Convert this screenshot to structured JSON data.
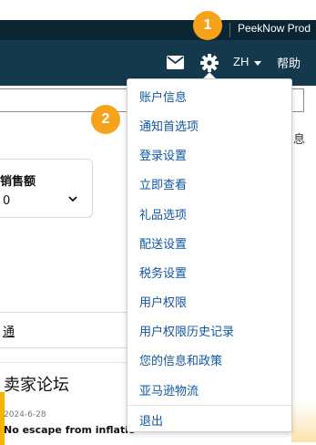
{
  "topbar": {
    "account": "PeekNow Prod"
  },
  "navbar": {
    "language": "ZH",
    "help": "帮助"
  },
  "icons": {
    "mail": "mail-icon",
    "settings": "gear-icon",
    "language_caret": "caret-down-icon"
  },
  "background": {
    "cutoff_text": "息",
    "sales_card": {
      "label": "销售额",
      "value": "0"
    },
    "tab_label": "通",
    "forum": {
      "title": "卖家论坛",
      "date": "2024-6-28",
      "post": "No escape from inflatio"
    }
  },
  "settings_menu": {
    "items": [
      "账户信息",
      "通知首选项",
      "登录设置",
      "立即查看",
      "礼品选项",
      "配送设置",
      "税务设置",
      "用户权限",
      "用户权限历史记录",
      "您的信息和政策",
      "亚马逊物流",
      "退出"
    ]
  },
  "annotations": {
    "badge_1": "1",
    "badge_2": "2"
  },
  "colors": {
    "topbar": "#0b2533",
    "navbar": "#14394d",
    "menu_link": "#0f56a3",
    "badge": "#f6a31b",
    "accent": "#f6b300"
  }
}
